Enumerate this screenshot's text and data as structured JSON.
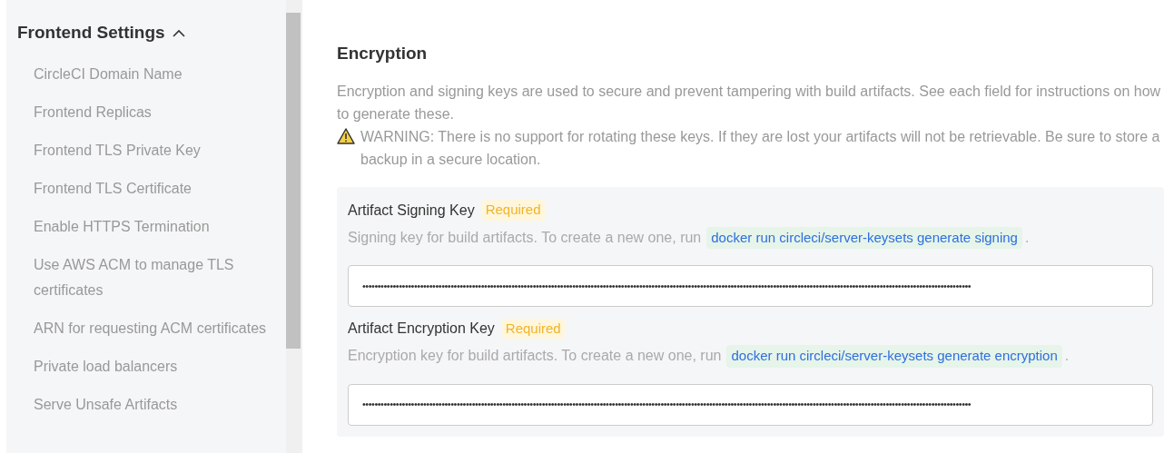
{
  "sidebar": {
    "section": {
      "title": "Frontend Settings",
      "expanded": true
    },
    "items": [
      {
        "label": "CircleCI Domain Name"
      },
      {
        "label": "Frontend Replicas"
      },
      {
        "label": "Frontend TLS Private Key"
      },
      {
        "label": "Frontend TLS Certificate"
      },
      {
        "label": "Enable HTTPS Termination"
      },
      {
        "label": "Use AWS ACM to manage TLS certificates"
      },
      {
        "label": "ARN for requesting ACM certificates"
      },
      {
        "label": "Private load balancers"
      },
      {
        "label": "Serve Unsafe Artifacts"
      }
    ]
  },
  "main": {
    "title": "Encryption",
    "description": "Encryption and signing keys are used to secure and prevent tampering with build artifacts. See each field for instructions on how to generate these.",
    "warning": "WARNING: There is no support for rotating these keys. If they are lost your artifacts will not be retrievable. Be sure to store a backup in a secure location.",
    "fields": [
      {
        "label": "Artifact Signing Key",
        "badge": "Required",
        "help": "Signing key for build artifacts. To create a new one, run",
        "command": "docker run circleci/server-keysets generate signing",
        "suffix": ".",
        "value": "••••••••••••••••••••••••••••••••••••••••••••••••••••••••••••••••••••••••••••••••••••••••••••••••••••••••••••••••••••••••••••••••••••••••••••••••••••••••••••••••••••••••••••••••••••••••••••••••••••••••"
      },
      {
        "label": "Artifact Encryption Key",
        "badge": "Required",
        "help": "Encryption key for build artifacts. To create a new one, run",
        "command": "docker run circleci/server-keysets generate encryption",
        "suffix": ".",
        "value": "••••••••••••••••••••••••••••••••••••••••••••••••••••••••••••••••••••••••••••••••••••••••••••••••••••••••••••••••••••••••••••••••••••••••••••••••••••••••••••••••••••••••••••••••••••••••••••••••••••••••"
      }
    ]
  }
}
